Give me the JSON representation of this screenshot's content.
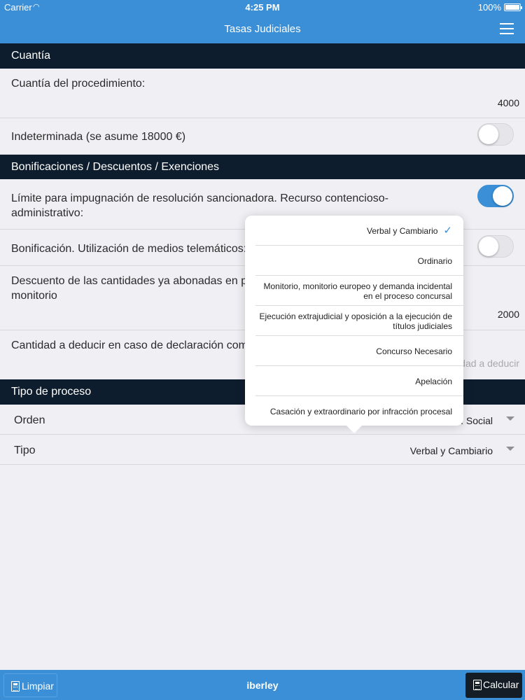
{
  "status_bar": {
    "carrier": "Carrier",
    "time": "4:25 PM",
    "battery": "100%"
  },
  "nav": {
    "title": "Tasas Judiciales"
  },
  "sections": {
    "cuantia": "Cuantía",
    "bonificaciones": "Bonificaciones / Descuentos / Exenciones",
    "tipo_proceso": "Tipo de proceso"
  },
  "cuantia": {
    "procedimiento_label": "Cuantía del procedimiento:",
    "procedimiento_value": "4000",
    "indeterminada_label": "Indeterminada (se asume 18000 €)",
    "indeterminada_on": false
  },
  "bonificaciones": {
    "limite_label": "Límite para impugnación de resolución sancionadora. Recurso contencioso-administrativo:",
    "limite_on": true,
    "telematicos_label": "Bonificación. Utilización de medios telemáticos:",
    "telematicos_on": false,
    "descuento_label_line1": "Descuento de las cantidades ya abonadas en pr",
    "descuento_label_line2": "monitorio",
    "descuento_value": "2000",
    "deducir_label": "Cantidad a deducir en caso de declaración com",
    "deducir_placeholder": "dad a deducir"
  },
  "tipo_proceso": {
    "orden_label": "Orden",
    "orden_value": ". Social",
    "tipo_label": "Tipo",
    "tipo_value": "Verbal y Cambiario"
  },
  "popover": {
    "selected": "Verbal y Cambiario",
    "options": [
      "Verbal y Cambiario",
      "Ordinario",
      "Monitorio, monitorio europeo y demanda incidental en el proceso concursal",
      "Ejecución extrajudicial y oposición a la ejecución de títulos judiciales",
      "Concurso Necesario",
      "Apelación",
      "Casación y extraordinario por infracción procesal"
    ]
  },
  "toolbar": {
    "limpiar_label": "Limpiar",
    "brand": "iberley",
    "calcular_label": "Calcular"
  },
  "colors": {
    "accent": "#3a8fd6",
    "section_header": "#0e1d2d",
    "background": "#efeff4"
  }
}
